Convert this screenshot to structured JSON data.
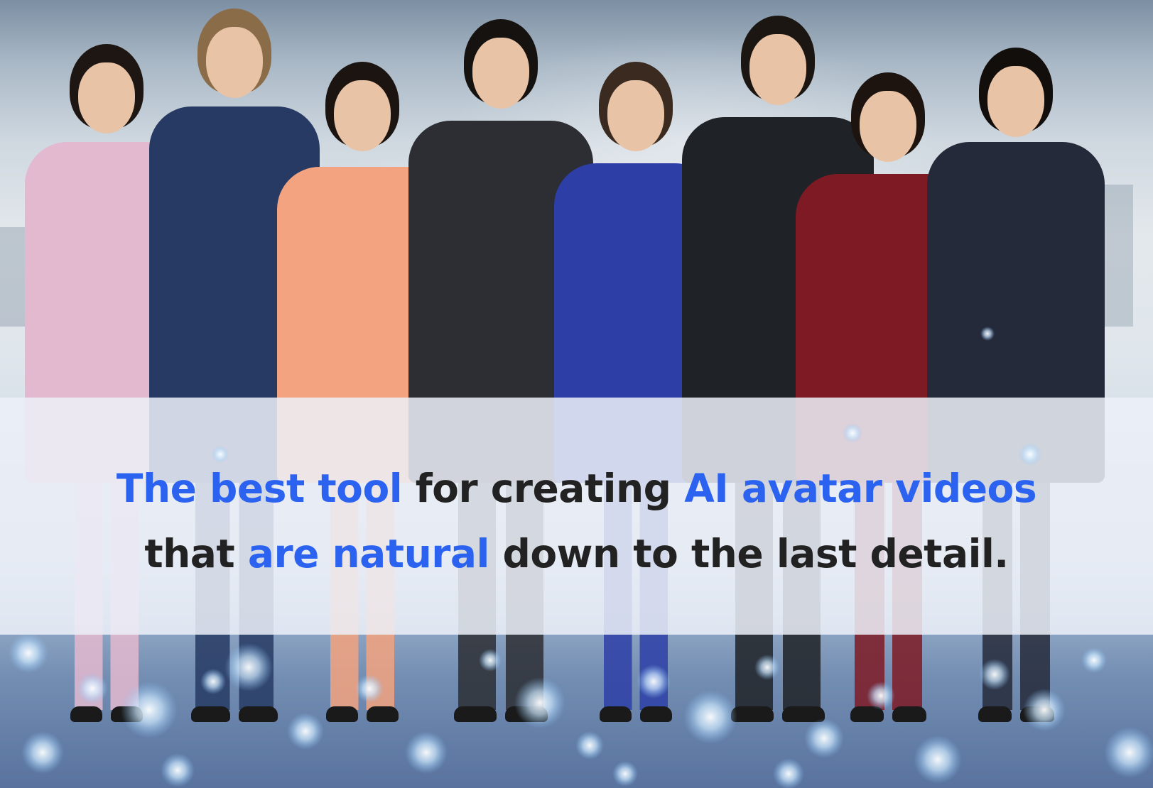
{
  "headline": {
    "line1": {
      "highlight_a": "The best tool",
      "plain": " for creating ",
      "highlight_b": "AI avatar videos"
    },
    "line2": {
      "plain_a": "that ",
      "highlight": "are natural",
      "plain_b": " down to the last detail."
    }
  },
  "colors": {
    "accent": "#2b63f0",
    "text": "#222222",
    "banner": "#ecf0f8"
  },
  "people": [
    {
      "name": "woman-pink-dress",
      "outfit": "#e2b9cf",
      "hair": "#1e1612"
    },
    {
      "name": "man-navy-suit",
      "outfit": "#263a63",
      "hair": "#8a6c48"
    },
    {
      "name": "woman-coral-jacket",
      "outfit": "#f3a37f",
      "hair": "#1c1410"
    },
    {
      "name": "man-black-suit-glasses",
      "outfit": "#2c2e33",
      "hair": "#15120f"
    },
    {
      "name": "woman-blue-dress",
      "outfit": "#2d3fa6",
      "hair": "#3a2a20"
    },
    {
      "name": "man-black-suit-beard",
      "outfit": "#1f2226",
      "hair": "#1c1612"
    },
    {
      "name": "woman-burgundy-suit",
      "outfit": "#7d1a24",
      "hair": "#1d1410"
    },
    {
      "name": "woman-dark-blazer",
      "outfit": "#252a3a",
      "hair": "#120e0c"
    }
  ]
}
